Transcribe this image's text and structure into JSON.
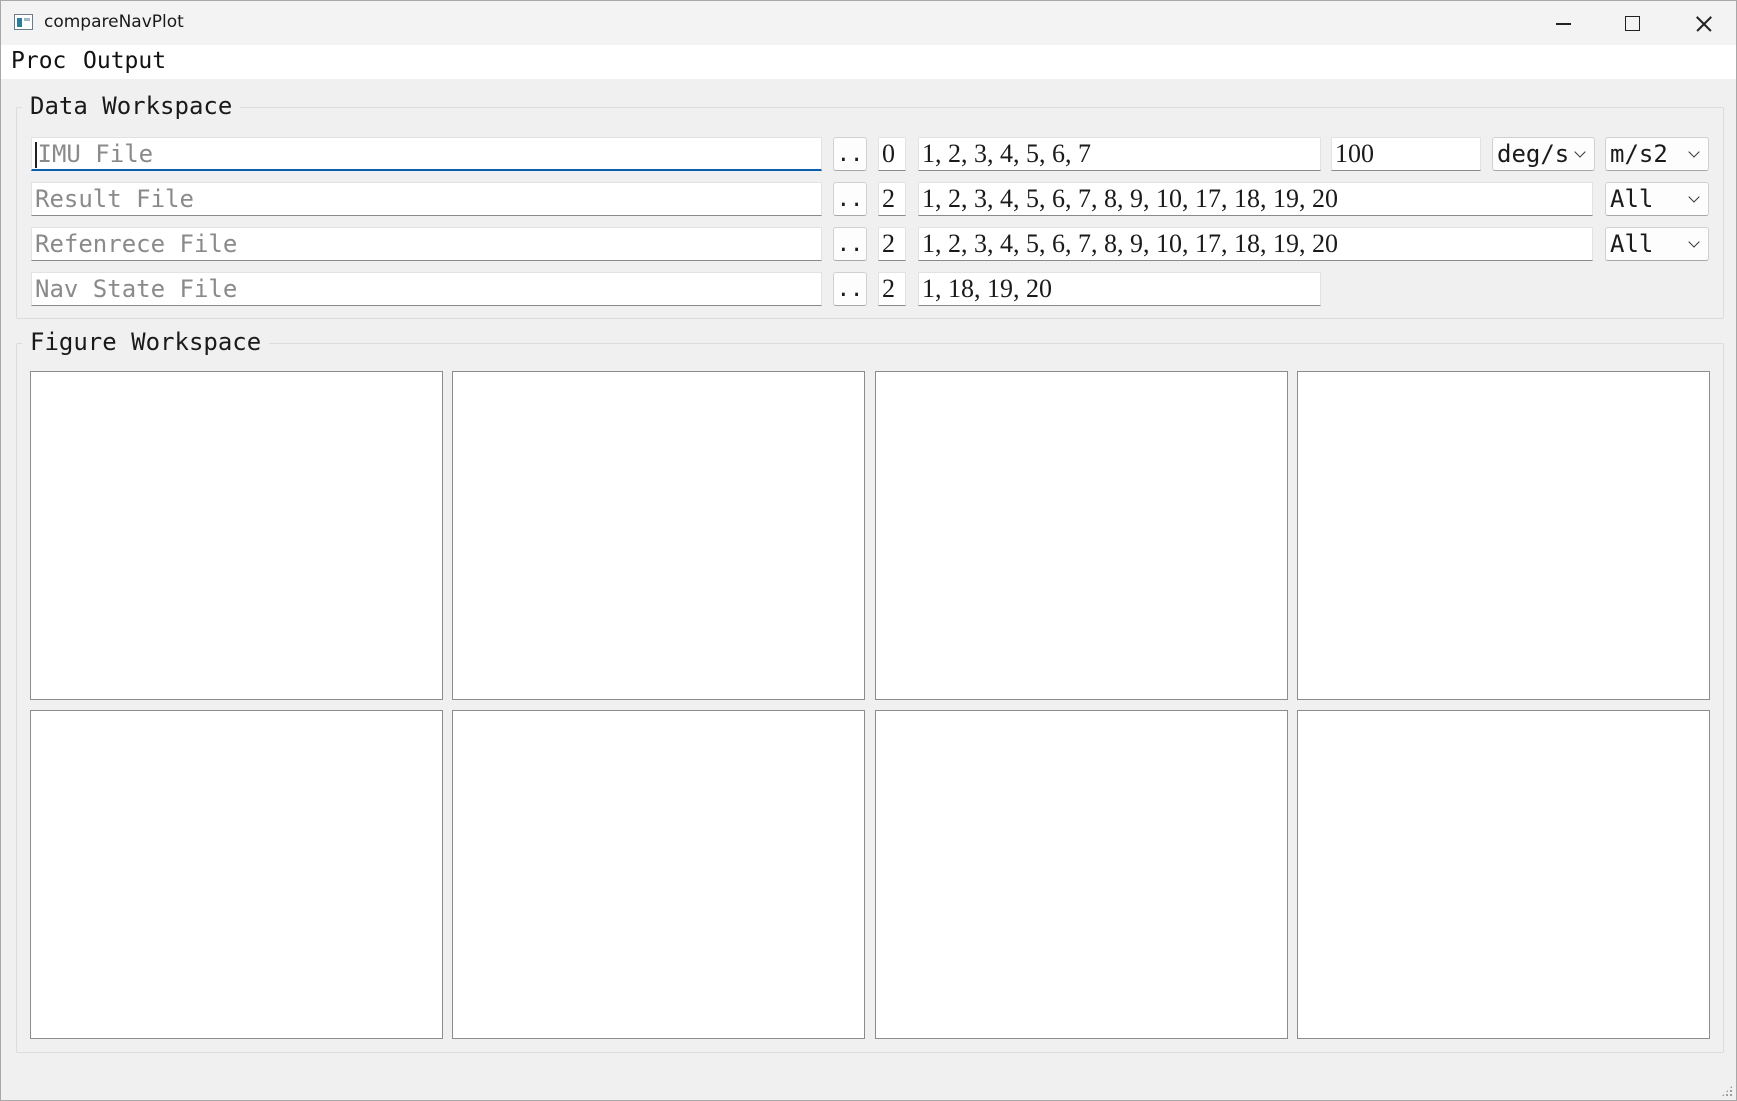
{
  "window": {
    "title": "compareNavPlot"
  },
  "menu": {
    "items": [
      "Proc",
      "Output"
    ]
  },
  "data_workspace": {
    "title": "Data Workspace",
    "imu": {
      "placeholder": "IMU File",
      "index": "0",
      "columns": "1, 2, 3, 4, 5, 6, 7",
      "rate": "100",
      "gyro_unit": "deg/s",
      "accel_unit": "m/s2"
    },
    "result": {
      "placeholder": "Result File",
      "index": "2",
      "columns": "1, 2, 3, 4, 5, 6, 7, 8, 9, 10, 17, 18, 19, 20",
      "mode": "All"
    },
    "reference": {
      "placeholder": "Refenrece File",
      "index": "2",
      "columns": "1, 2, 3, 4, 5, 6, 7, 8, 9, 10, 17, 18, 19, 20",
      "mode": "All"
    },
    "nav_state": {
      "placeholder": "Nav State File",
      "index": "2",
      "columns": "1, 18, 19, 20"
    },
    "browse_label": ".."
  },
  "figure_workspace": {
    "title": "Figure Workspace",
    "plot_count": 8
  }
}
